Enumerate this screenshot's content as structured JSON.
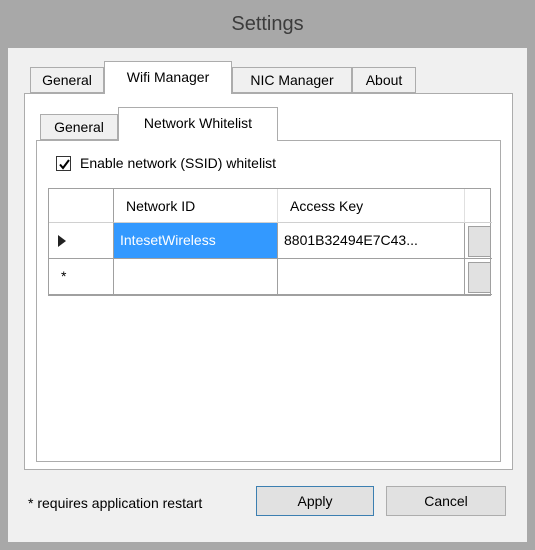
{
  "window": {
    "title": "Settings"
  },
  "tabs": [
    {
      "label": "General",
      "active": false
    },
    {
      "label": "Wifi Manager",
      "active": true
    },
    {
      "label": "NIC Manager",
      "active": false
    },
    {
      "label": "About",
      "active": false
    }
  ],
  "subtabs": [
    {
      "label": "General",
      "active": false
    },
    {
      "label": "Network Whitelist",
      "active": true
    }
  ],
  "whitelist": {
    "checkbox_label": "Enable network (SSID) whitelist",
    "checked": true
  },
  "grid": {
    "columns": [
      "Network ID",
      "Access Key"
    ],
    "rows": [
      {
        "marker": "current-row-arrow-icon",
        "network_id": "IntesetWireless",
        "access_key": "8801B32494E7C43..."
      },
      {
        "marker": "*",
        "network_id": "",
        "access_key": ""
      }
    ]
  },
  "footer": {
    "note": "* requires application restart",
    "apply_label": "Apply",
    "cancel_label": "Cancel"
  },
  "colors": {
    "selection": "#3399ff",
    "frame": "#a8a8a8"
  }
}
